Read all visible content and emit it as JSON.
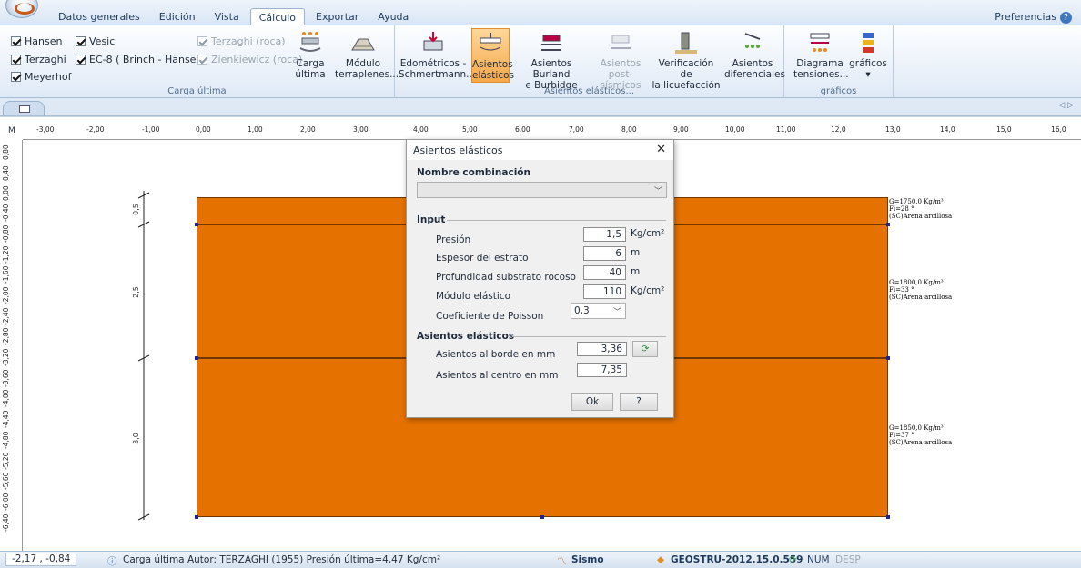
{
  "menu": {
    "tabs": [
      "Datos generales",
      "Edición",
      "Vista",
      "Cálculo",
      "Exportar",
      "Ayuda"
    ],
    "active": "Cálculo",
    "preferences": "Preferencias"
  },
  "ribbon": {
    "carga_ultima": {
      "label": "Carga última",
      "checks": [
        {
          "label": "Hansen",
          "checked": true,
          "enabled": true
        },
        {
          "label": "Vesic",
          "checked": true,
          "enabled": true
        },
        {
          "label": "Terzaghi (roca)",
          "checked": true,
          "enabled": false
        },
        {
          "label": "Terzaghi",
          "checked": true,
          "enabled": true
        },
        {
          "label": "EC-8 ( Brinch - Hansen)",
          "checked": true,
          "enabled": true
        },
        {
          "label": "Zienkiewicz (roca)",
          "checked": true,
          "enabled": false
        },
        {
          "label": "Meyerhof",
          "checked": true,
          "enabled": true
        }
      ],
      "btn_carga": [
        "Carga",
        "última"
      ],
      "btn_modulo": [
        "Módulo",
        "terraplenes..."
      ]
    },
    "asientos": {
      "label": "Asientos elásticos...",
      "buttons": [
        {
          "l1": "Edométricos -",
          "l2": "Schmertmann..."
        },
        {
          "l1": "Asientos",
          "l2": "elásticos"
        },
        {
          "l1": "Asientos Burland",
          "l2": "e Burbidge"
        },
        {
          "l1": "Asientos",
          "l2": "post-sísmicos"
        },
        {
          "l1": "Verificación de",
          "l2": "la licuefacción"
        },
        {
          "l1": "Asientos",
          "l2": "diferenciales"
        }
      ]
    },
    "graficos": {
      "label": "gráficos",
      "buttons": [
        {
          "l1": "Diagrama",
          "l2": "tensiones..."
        },
        {
          "l1": "gráficos",
          "l2": "▾"
        }
      ]
    }
  },
  "ruler": {
    "unit": "M",
    "h_ticks": [
      "-3,00",
      "-2,00",
      "-1,00",
      "0,00",
      "1,00",
      "2,00",
      "3,00",
      "4,00",
      "5,00",
      "6,00",
      "7,00",
      "8,00",
      "9,00",
      "10,00",
      "11,00",
      "12,0",
      "13,0",
      "14,0",
      "15,0",
      "16,0"
    ],
    "v_ticks": [
      "0,80",
      "0,40",
      "0,00",
      "-0,40",
      "-0,80",
      "-1,20",
      "-1,60",
      "-2,00",
      "-2,40",
      "-2,80",
      "-3,20",
      "-3,60",
      "-4,00",
      "-4,40",
      "-4,80",
      "-5,20",
      "-5,60",
      "-6,00",
      "-6,40"
    ]
  },
  "drawing": {
    "dims": [
      "0,5",
      "2,5",
      "3,0"
    ],
    "layers": [
      {
        "line1": "G=1750,0 Kg/m³",
        "line2": "Fi=28 °",
        "line3": "(SC)Arena arcillosa"
      },
      {
        "line1": "G=1800,0 Kg/m³",
        "line2": "Fi=33 °",
        "line3": "(SC)Arena arcillosa"
      },
      {
        "line1": "G=1850,0 Kg/m³",
        "line2": "Fi=37 °",
        "line3": "(SC)Arena arcillosa"
      }
    ]
  },
  "dialog": {
    "title": "Asientos elásticos",
    "close": "✕",
    "nombre_label": "Nombre combinación",
    "input_section": "Input",
    "fields": [
      {
        "label": "Presión",
        "value": "1,5",
        "unit": "Kg/cm²"
      },
      {
        "label": "Espesor del estrato",
        "value": "6",
        "unit": "m"
      },
      {
        "label": "Profundidad substrato rocoso",
        "value": "40",
        "unit": "m"
      },
      {
        "label": "Módulo elástico",
        "value": "110",
        "unit": "Kg/cm²"
      }
    ],
    "poisson_label": "Coeficiente de Poisson",
    "poisson_value": "0,3",
    "result_section": "Asientos elásticos",
    "borde_label": "Asientos al borde en mm",
    "borde_value": "3,36",
    "centro_label": "Asientos al centro en mm",
    "centro_value": "7,35",
    "ok": "Ok",
    "help": "?"
  },
  "status": {
    "coords": "-2,17 , -0,84",
    "message": "Carga última Autor: TERZAGHI (1955) Presión última=4,47 Kg/cm²",
    "sismo": "Sismo",
    "version": "GEOSTRU-2012.15.0.559",
    "num": "NUM",
    "desp": "DESP"
  },
  "colors": {
    "soil": "#e57200",
    "accent": "#f5a84a"
  }
}
